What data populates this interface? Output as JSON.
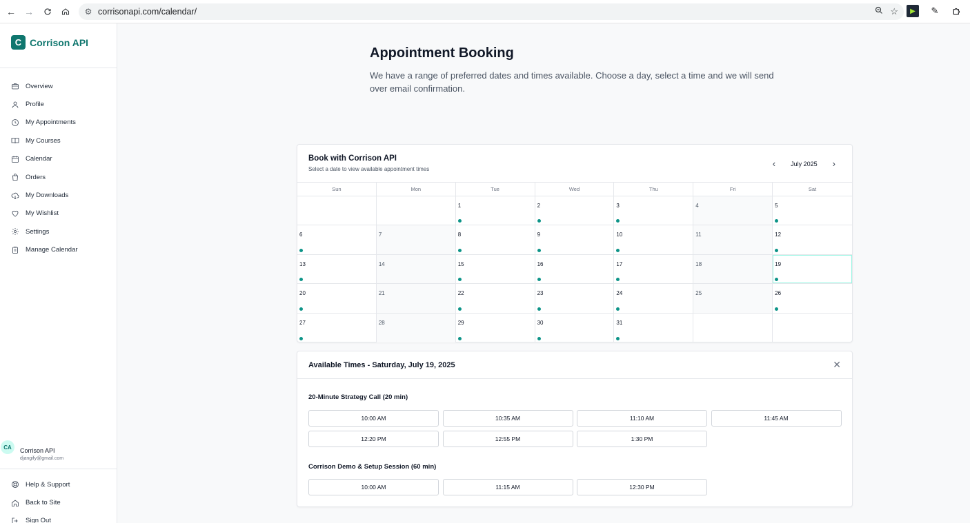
{
  "browser": {
    "url": "corrisonapi.com/calendar/"
  },
  "sidebar": {
    "brand_letter": "C",
    "brand_name": "Corrison API",
    "items": [
      {
        "label": "Overview",
        "icon": "briefcase-icon"
      },
      {
        "label": "Profile",
        "icon": "user-icon"
      },
      {
        "label": "My Appointments",
        "icon": "clock-icon"
      },
      {
        "label": "My Courses",
        "icon": "book-open-icon"
      },
      {
        "label": "Calendar",
        "icon": "calendar-icon"
      },
      {
        "label": "Orders",
        "icon": "shopping-bag-icon"
      },
      {
        "label": "My Downloads",
        "icon": "cloud-download-icon"
      },
      {
        "label": "My Wishlist",
        "icon": "heart-icon"
      },
      {
        "label": "Settings",
        "icon": "gear-icon"
      },
      {
        "label": "Manage Calendar",
        "icon": "clipboard-icon"
      }
    ],
    "user": {
      "initials": "CA",
      "name": "Corrison API",
      "email": "djangify@gmail.com"
    },
    "bottom_items": [
      {
        "label": "Help & Support",
        "icon": "lifebuoy-icon"
      },
      {
        "label": "Back to Site",
        "icon": "home-icon"
      },
      {
        "label": "Sign Out",
        "icon": "sign-out-icon"
      }
    ]
  },
  "main": {
    "title": "Appointment Booking",
    "subtitle": "We have a range of preferred dates and times available. Choose a day, select a time and we will send over email confirmation."
  },
  "calendar": {
    "title": "Book with Corrison API",
    "hint": "Select a date to view available appointment times",
    "month_label": "July 2025",
    "weekdays": [
      "Sun",
      "Mon",
      "Tue",
      "Wed",
      "Thu",
      "Fri",
      "Sat"
    ],
    "weeks": [
      [
        null,
        null,
        {
          "d": "1",
          "avail": true
        },
        {
          "d": "2",
          "avail": true
        },
        {
          "d": "3",
          "avail": true
        },
        {
          "d": "4",
          "avail": false
        },
        {
          "d": "5",
          "avail": true
        }
      ],
      [
        {
          "d": "6",
          "avail": true
        },
        {
          "d": "7",
          "avail": false
        },
        {
          "d": "8",
          "avail": true
        },
        {
          "d": "9",
          "avail": true
        },
        {
          "d": "10",
          "avail": true
        },
        {
          "d": "11",
          "avail": false
        },
        {
          "d": "12",
          "avail": true
        }
      ],
      [
        {
          "d": "13",
          "avail": true
        },
        {
          "d": "14",
          "avail": false
        },
        {
          "d": "15",
          "avail": true
        },
        {
          "d": "16",
          "avail": true
        },
        {
          "d": "17",
          "avail": true
        },
        {
          "d": "18",
          "avail": false
        },
        {
          "d": "19",
          "avail": true,
          "selected": true
        }
      ],
      [
        {
          "d": "20",
          "avail": true
        },
        {
          "d": "21",
          "avail": false
        },
        {
          "d": "22",
          "avail": true
        },
        {
          "d": "23",
          "avail": true
        },
        {
          "d": "24",
          "avail": true
        },
        {
          "d": "25",
          "avail": false
        },
        {
          "d": "26",
          "avail": true
        }
      ],
      [
        {
          "d": "27",
          "avail": true
        },
        {
          "d": "28",
          "avail": false
        },
        {
          "d": "29",
          "avail": true
        },
        {
          "d": "30",
          "avail": true
        },
        {
          "d": "31",
          "avail": true
        },
        null,
        null
      ]
    ]
  },
  "times": {
    "title": "Available Times - Saturday, July 19, 2025",
    "services": [
      {
        "name": "20-Minute Strategy Call (20 min)",
        "slots": [
          "10:00 AM",
          "10:35 AM",
          "11:10 AM",
          "11:45 AM",
          "12:20 PM",
          "12:55 PM",
          "1:30 PM"
        ]
      },
      {
        "name": "Corrison Demo & Setup Session (60 min)",
        "slots": [
          "10:00 AM",
          "11:15 AM",
          "12:30 PM"
        ]
      }
    ]
  },
  "colors": {
    "accent": "#0f766e",
    "dot": "#0d9488"
  }
}
